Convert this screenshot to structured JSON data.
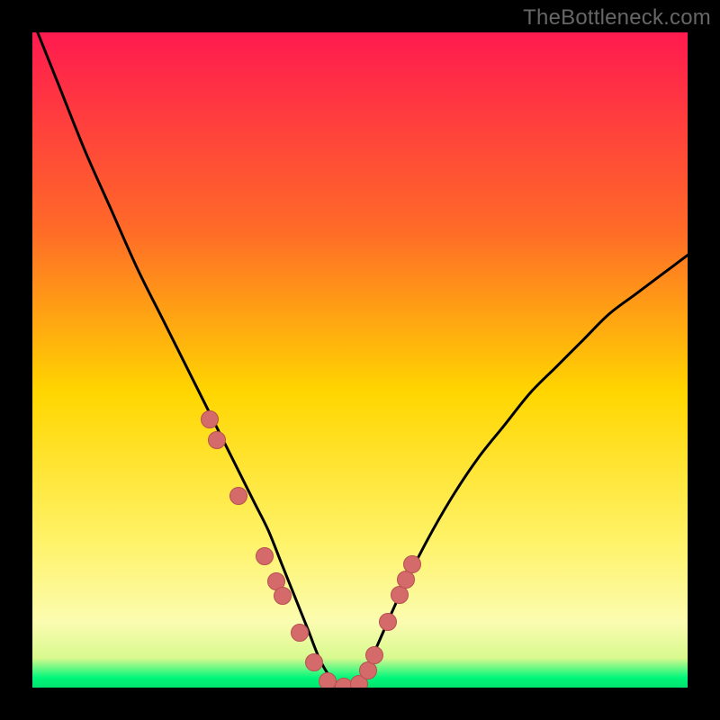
{
  "watermark": "TheBottleneck.com",
  "colors": {
    "grad_top": "#ff1a4f",
    "grad_mid1": "#ff6a28",
    "grad_mid2": "#ffd600",
    "grad_low": "#fff36a",
    "grad_pale": "#fbfcb0",
    "grad_green": "#00f77a",
    "dot_fill": "#d56a6a",
    "curve": "#000000",
    "frame": "#000000"
  },
  "chart_data": {
    "type": "line",
    "title": "",
    "xlabel": "",
    "ylabel": "",
    "xlim": [
      0,
      100
    ],
    "ylim": [
      0,
      100
    ],
    "series": [
      {
        "name": "bottleneck-curve",
        "x": [
          0,
          4,
          8,
          12,
          16,
          20,
          24,
          28,
          32,
          34,
          36,
          38,
          40,
          42,
          44,
          46,
          48,
          50,
          52,
          56,
          60,
          64,
          68,
          72,
          76,
          80,
          84,
          88,
          92,
          96,
          100
        ],
        "y": [
          102,
          92,
          82,
          73,
          64,
          56,
          48,
          40,
          32,
          28,
          24,
          19,
          14,
          9,
          4,
          1,
          0,
          1,
          5,
          14,
          22,
          29,
          35,
          40,
          45,
          49,
          53,
          57,
          60,
          63,
          66
        ]
      }
    ],
    "points": {
      "name": "sample-dots",
      "x": [
        27.0,
        28.2,
        31.5,
        35.5,
        37.2,
        38.2,
        40.8,
        43.0,
        45.0,
        47.5,
        49.8,
        51.2,
        52.2,
        54.3,
        56.0,
        57.0,
        58.0
      ],
      "y": [
        41.0,
        37.8,
        29.2,
        20.0,
        16.2,
        14.0,
        8.4,
        3.9,
        1.0,
        0.2,
        0.6,
        2.6,
        5.0,
        10.0,
        14.2,
        16.5,
        18.8
      ]
    },
    "gradient_stops": [
      {
        "offset": 0.0,
        "color": "#ff1a4f"
      },
      {
        "offset": 0.3,
        "color": "#ff6a28"
      },
      {
        "offset": 0.55,
        "color": "#ffd600"
      },
      {
        "offset": 0.78,
        "color": "#fff36a"
      },
      {
        "offset": 0.9,
        "color": "#fbfcb0"
      },
      {
        "offset": 0.955,
        "color": "#d8f98f"
      },
      {
        "offset": 0.985,
        "color": "#00f77a"
      },
      {
        "offset": 1.0,
        "color": "#00e46e"
      }
    ]
  }
}
